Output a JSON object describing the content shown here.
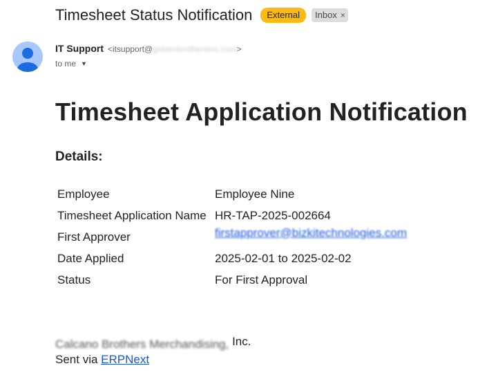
{
  "email": {
    "subject": "Timesheet Status Notification",
    "labels": {
      "external": "External",
      "inbox": "Inbox",
      "inbox_remove": "×"
    },
    "sender": {
      "name": "IT Support",
      "email_prefix": "<itsupport@",
      "email_domain_obscured": "goldenbrothersinc.com",
      "email_suffix": ">",
      "avatar_icon": "person-icon"
    },
    "to_label": "to me",
    "to_caret": "▼"
  },
  "body": {
    "heading": "Timesheet Application Notification",
    "details_heading": "Details:",
    "rows": [
      {
        "label": "Employee",
        "value": "Employee Nine"
      },
      {
        "label": "Timesheet Application Name",
        "value": "HR-TAP-2025-002664"
      },
      {
        "label": "First Approver",
        "value": "firstapprover@bizkitechnologies.com"
      },
      {
        "label": "Date Applied",
        "value": "2025-02-01 to 2025-02-02"
      },
      {
        "label": "Status",
        "value": "For First Approval"
      }
    ],
    "footer": {
      "company_obscured": "Calcano Brothers Merchandising,",
      "company_visible": " Inc.",
      "sent_via_prefix": "Sent via ",
      "sent_via_link": "ERPNext"
    }
  },
  "colors": {
    "external_chip": "#f9bb14",
    "inbox_chip": "#dddddd",
    "avatar_bg": "#a8c7fa",
    "avatar_fg": "#1a6ce0",
    "link": "#1a56d6"
  }
}
